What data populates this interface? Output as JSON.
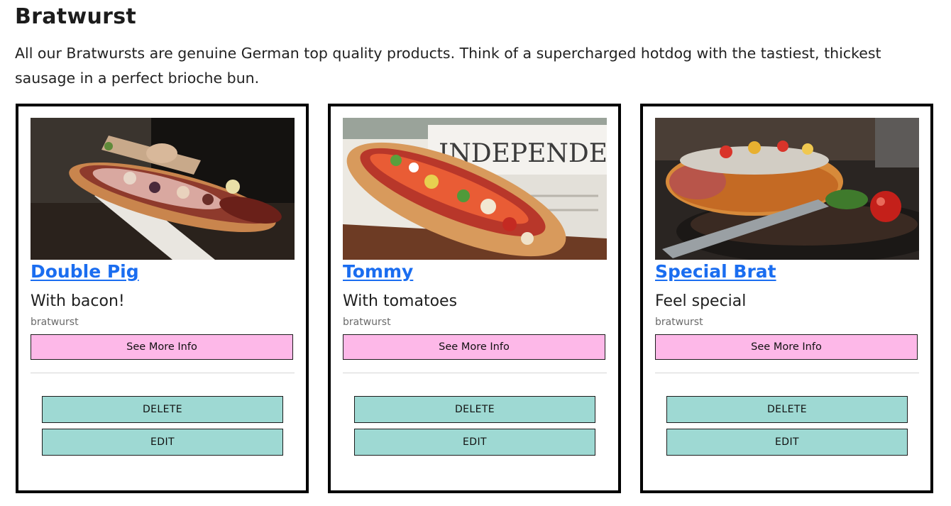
{
  "header": {
    "title": "Bratwurst",
    "description": "All our Bratwursts are genuine German top quality products. Think of a supercharged hotdog with the tastiest, thickest sausage in a perfect brioche bun."
  },
  "cards": [
    {
      "name": "Double Pig",
      "tagline": "With bacon!",
      "category": "bratwurst",
      "more_label": "See More Info",
      "delete_label": "DELETE",
      "edit_label": "EDIT"
    },
    {
      "name": "Tommy",
      "tagline": "With tomatoes",
      "category": "bratwurst",
      "more_label": "See More Info",
      "delete_label": "DELETE",
      "edit_label": "EDIT"
    },
    {
      "name": "Special Brat",
      "tagline": "Feel special",
      "category": "bratwurst",
      "more_label": "See More Info",
      "delete_label": "DELETE",
      "edit_label": "EDIT"
    }
  ],
  "colors": {
    "link": "#1a6df0",
    "more_button": "#fdb8e8",
    "action_button": "#9ed9d3",
    "card_border": "#000000"
  }
}
